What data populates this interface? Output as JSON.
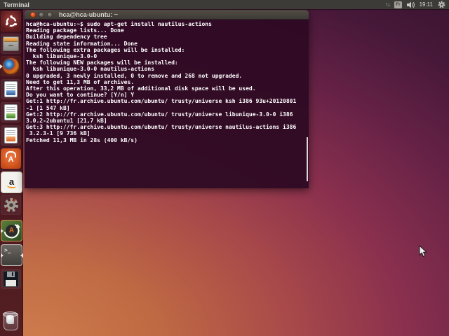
{
  "panel": {
    "active_app_label": "Terminal",
    "network_icon_glyph": "↑↓",
    "keyboard_layout": "Fr",
    "clock": "19:11"
  },
  "launcher": {
    "items": [
      {
        "id": "dash",
        "label": "Ubuntu Dash"
      },
      {
        "id": "files",
        "label": "Files"
      },
      {
        "id": "firefox",
        "label": "Firefox",
        "running": true
      },
      {
        "id": "writer",
        "label": "LibreOffice Writer"
      },
      {
        "id": "calc",
        "label": "LibreOffice Calc"
      },
      {
        "id": "impress",
        "label": "LibreOffice Impress"
      },
      {
        "id": "software-center",
        "label": "Ubuntu Software Center",
        "badge": "A"
      },
      {
        "id": "amazon",
        "label": "Amazon",
        "glyph": "a"
      },
      {
        "id": "settings",
        "label": "System Settings"
      },
      {
        "id": "updater",
        "label": "Software Updater",
        "badge": "A",
        "running": true
      },
      {
        "id": "terminal",
        "label": "Terminal",
        "glyph": ">_",
        "running": true,
        "focused": true
      },
      {
        "id": "floppy",
        "label": "Floppy Disk"
      },
      {
        "id": "trash",
        "label": "Trash"
      }
    ]
  },
  "terminal_window": {
    "title": "hca@hca-ubuntu: ~",
    "background": "#300a24",
    "lines": [
      "hca@hca-ubuntu:~$ sudo apt-get install nautilus-actions",
      "Reading package lists... Done",
      "Building dependency tree",
      "Reading state information... Done",
      "The following extra packages will be installed:",
      "  ksh libunique-3.0-0",
      "The following NEW packages will be installed:",
      "  ksh libunique-3.0-0 nautilus-actions",
      "0 upgraded, 3 newly installed, 0 to remove and 268 not upgraded.",
      "Need to get 11,3 MB of archives.",
      "After this operation, 33,2 MB of additional disk space will be used.",
      "Do you want to continue? [Y/n] Y",
      "Get:1 http://fr.archive.ubuntu.com/ubuntu/ trusty/universe ksh i386 93u+20120801",
      "-1 [1 547 kB]",
      "Get:2 http://fr.archive.ubuntu.com/ubuntu/ trusty/universe libunique-3.0-0 i386",
      "3.0.2-2ubuntu1 [21,7 kB]",
      "Get:3 http://fr.archive.ubuntu.com/ubuntu/ trusty/universe nautilus-actions i386",
      " 3.2.3-1 [9 736 kB]",
      "Fetched 11,3 MB in 28s (400 kB/s)"
    ]
  },
  "colors": {
    "panel_bg": "#3c3b37",
    "terminal_bg": "#300a24",
    "close_button": "#dd4814",
    "wallpaper_orange": "#c06a43",
    "wallpaper_purple": "#3a1430"
  }
}
